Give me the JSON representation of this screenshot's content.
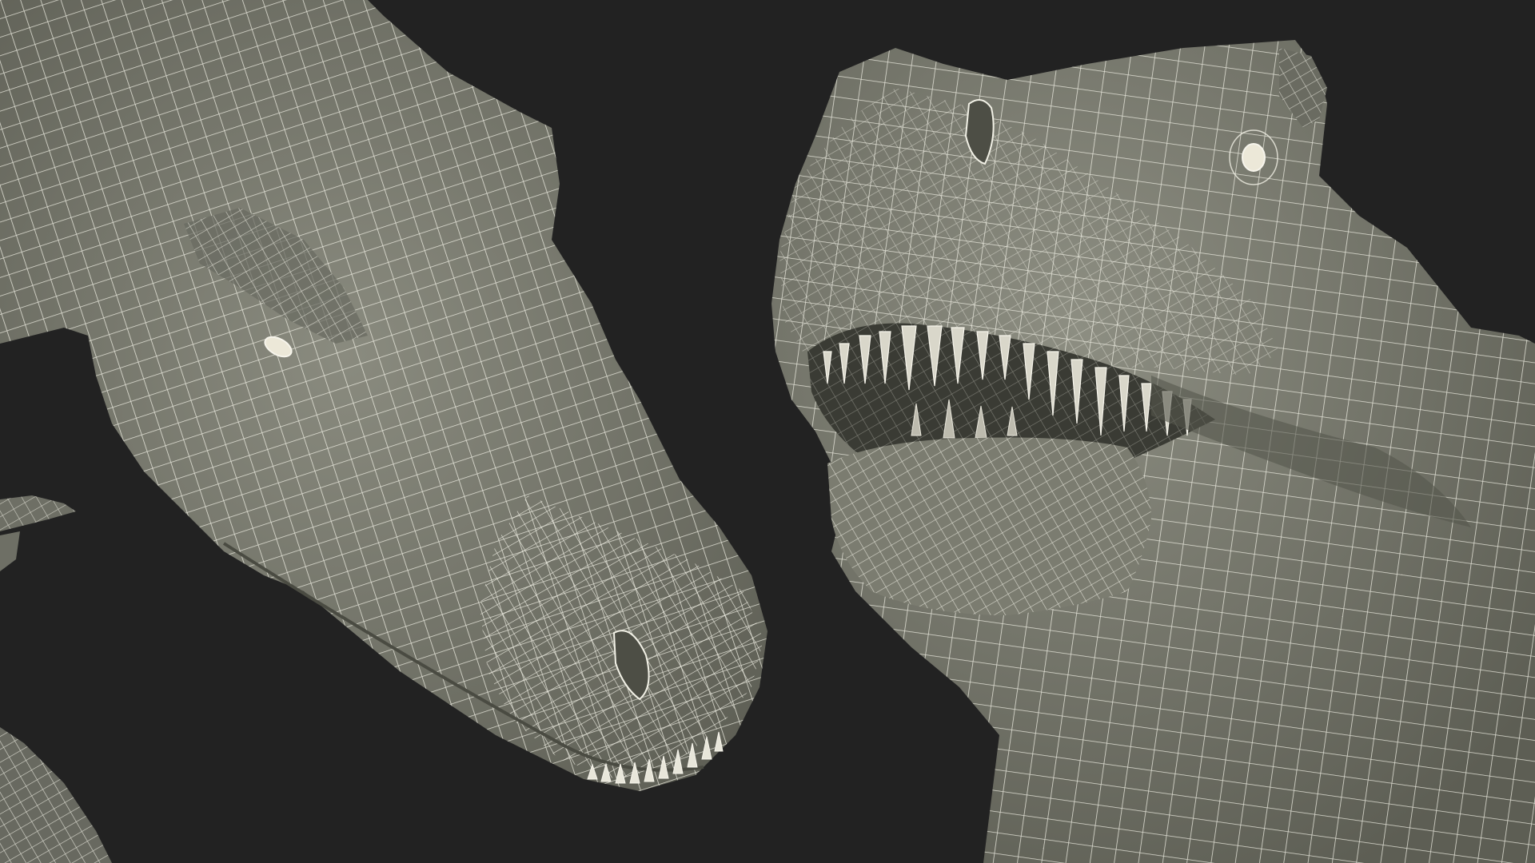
{
  "scene": {
    "background_color": "#222222",
    "mesh_fill_color": "#7d7e72",
    "mesh_shadow_color": "#5c5d53",
    "wire_color": "#f2f1e6",
    "eye_color": "#ece8d8",
    "subjects": [
      {
        "name": "t-rex-head-side-view",
        "mouth": "closed"
      },
      {
        "name": "t-rex-head-front-view",
        "mouth": "open"
      }
    ]
  }
}
